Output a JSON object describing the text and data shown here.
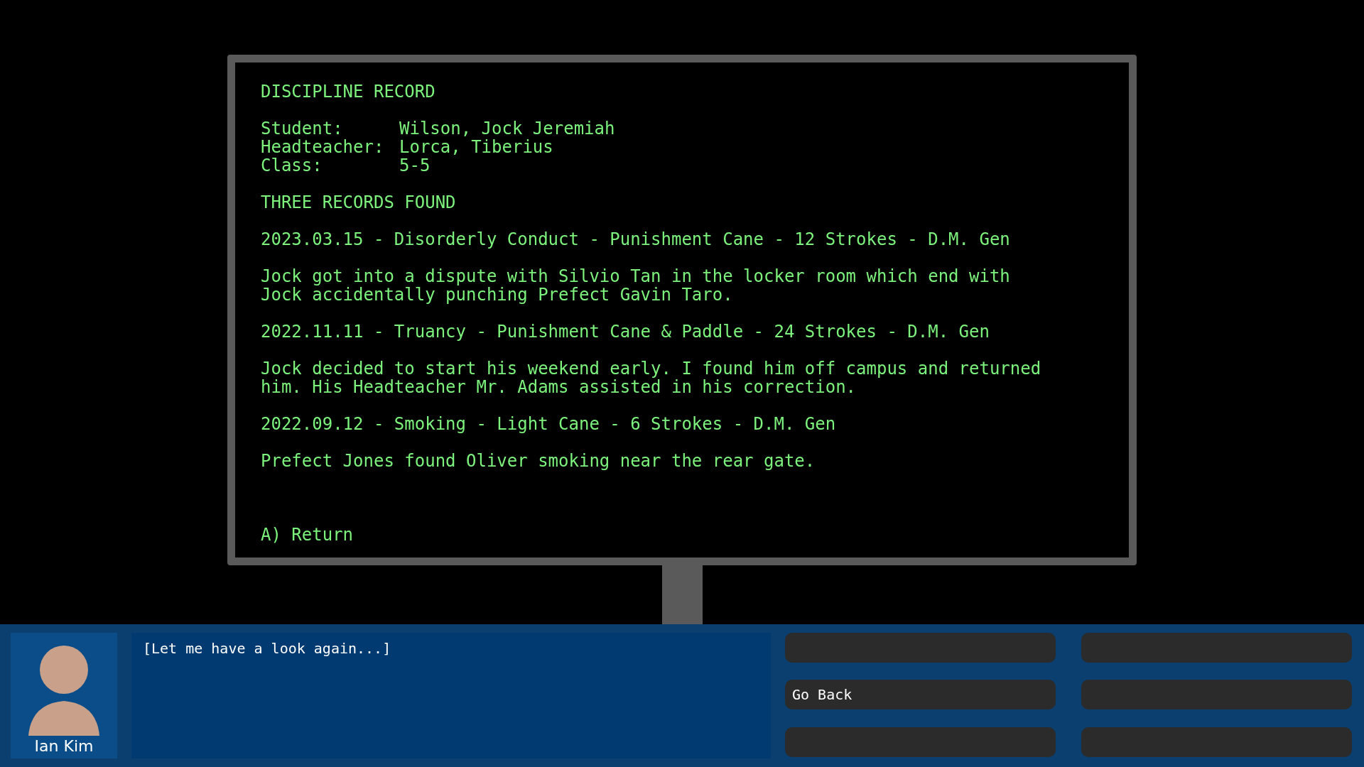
{
  "terminal": {
    "title": "DISCIPLINE RECORD",
    "fields": [
      {
        "label": "Student:",
        "value": "Wilson, Jock Jeremiah"
      },
      {
        "label": "Headteacher:",
        "value": "Lorca, Tiberius"
      },
      {
        "label": "Class:",
        "value": "5-5"
      }
    ],
    "status": "THREE RECORDS FOUND",
    "records": [
      {
        "heading": "2023.03.15 - Disorderly Conduct - Punishment Cane - 12 Strokes - D.M. Gen",
        "note": "Jock got into a dispute with Silvio Tan in the locker room which end with\nJock accidentally punching Prefect Gavin Taro."
      },
      {
        "heading": "2022.11.11 - Truancy - Punishment Cane & Paddle - 24 Strokes - D.M. Gen",
        "note": "Jock decided to start his weekend early. I found him off campus and returned\nhim. His Headteacher Mr. Adams assisted in his correction."
      },
      {
        "heading": "2022.09.12 - Smoking - Light Cane - 6 Strokes - D.M. Gen",
        "note": "Prefect Jones found Oliver smoking near the rear gate."
      }
    ],
    "option": "A) Return"
  },
  "dialogue": {
    "speaker": "Ian Kim",
    "text": "[Let me have a look again...]"
  },
  "choices": [
    {
      "kind": "empty"
    },
    {
      "kind": "empty"
    },
    {
      "kind": "option",
      "label": "Go Back"
    },
    {
      "kind": "empty"
    },
    {
      "kind": "empty"
    },
    {
      "kind": "empty"
    }
  ]
}
